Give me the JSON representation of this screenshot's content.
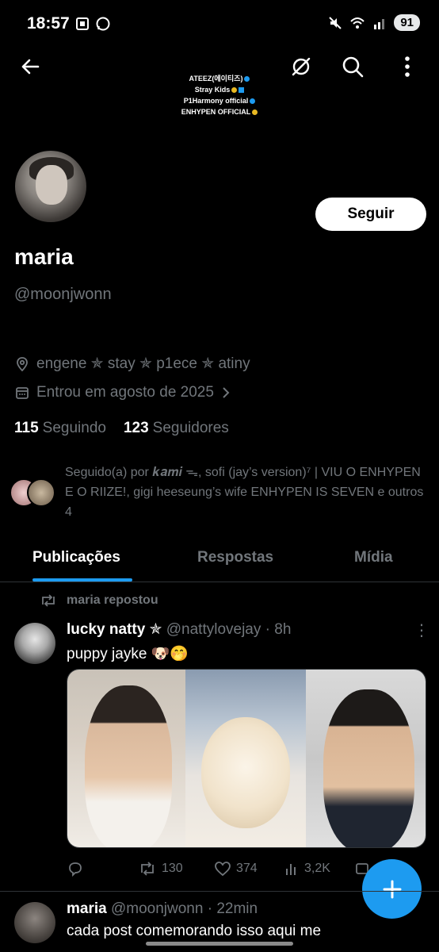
{
  "status_bar": {
    "time": "18:57",
    "battery": "91"
  },
  "banner": {
    "lines": [
      "ATEEZ(에이티즈)",
      "Stray Kids",
      "P1Harmony official",
      "ENHYPEN OFFICIAL"
    ]
  },
  "profile": {
    "follow_label": "Seguir",
    "name": "maria",
    "handle": "@moonjwonn",
    "bio_location": "engene ✯ stay ✯ p1ece ✯ atiny",
    "joined": "Entrou em agosto de 2025",
    "following_count": "115",
    "following_label": "Seguindo",
    "followers_count": "123",
    "followers_label": "Seguidores",
    "followed_by": "Seguido(a) por 𝒌𝒂𝒎𝒊 ᯓ, sofi (jay’s version)⁷ | VIU O ENHYPEN E O RIIZE!, gigi heeseung’s wife ENHYPEN IS SEVEN e outros 4"
  },
  "tabs": [
    {
      "label": "Publicações",
      "active": true
    },
    {
      "label": "Respostas",
      "active": false
    },
    {
      "label": "Mídia",
      "active": false
    }
  ],
  "feed": {
    "repost_label": "maria repostou",
    "post1": {
      "author": "lucky natty ✯",
      "handle_time": "@nattylovejay · 8h",
      "text": "puppy jayke 🐶🤭",
      "replies": "",
      "retweets": "130",
      "likes": "374",
      "views": "3,2K"
    },
    "post2": {
      "author": "maria",
      "handle_time": "@moonjwonn · 22min",
      "text": "cada post comemorando isso aqui me"
    }
  },
  "colors": {
    "accent": "#1d9bf0",
    "background": "#000000",
    "muted": "#71767b"
  }
}
